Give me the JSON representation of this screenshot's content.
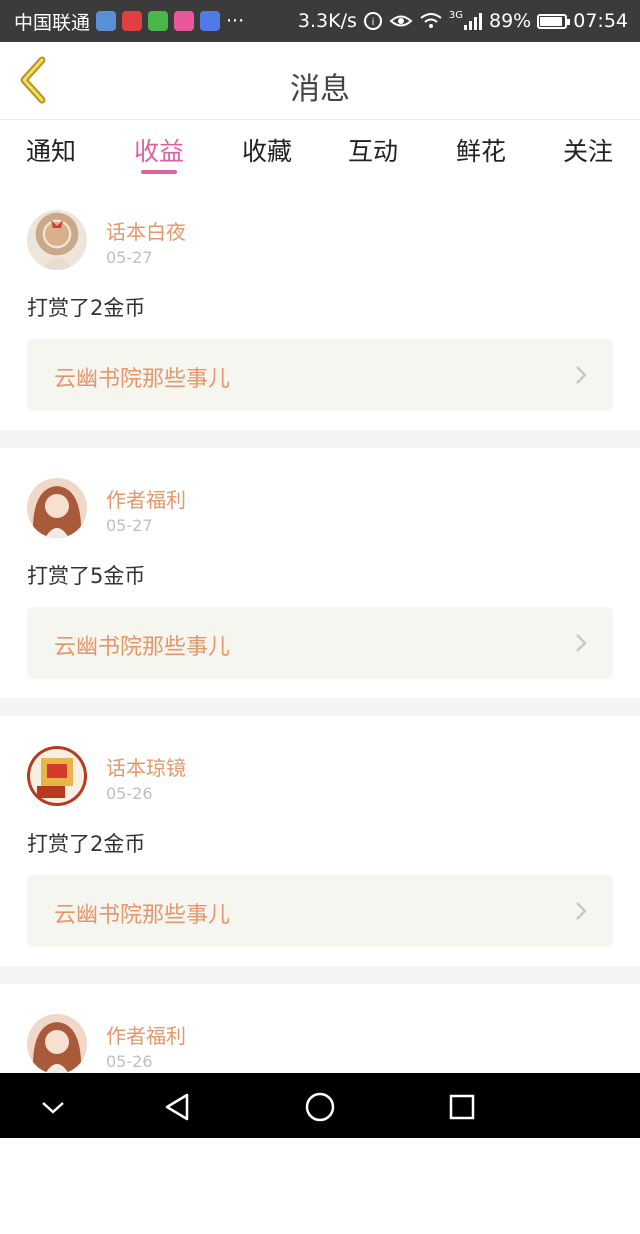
{
  "status_bar": {
    "carrier": "中国联通",
    "more": "···",
    "speed": "3.3K/s",
    "network": "3G",
    "battery": "89%",
    "battery_level": 0.89,
    "time": "07:54"
  },
  "header": {
    "title": "消息"
  },
  "tabs": [
    {
      "label": "通知"
    },
    {
      "label": "收益"
    },
    {
      "label": "收藏"
    },
    {
      "label": "互动"
    },
    {
      "label": "鲜花"
    },
    {
      "label": "关注"
    }
  ],
  "active_tab": "收益",
  "items": [
    {
      "name": "话本白夜",
      "date": "05-27",
      "message": "打赏了2金币",
      "book": "云幽书院那些事儿"
    },
    {
      "name": "作者福利",
      "date": "05-27",
      "message": "打赏了5金币",
      "book": "云幽书院那些事儿"
    },
    {
      "name": "话本琼镜",
      "date": "05-26",
      "message": "打赏了2金币",
      "book": "云幽书院那些事儿"
    },
    {
      "name": "作者福利",
      "date": "05-26"
    }
  ],
  "colors": {
    "accent": "#e061a1",
    "name": "#e5976a",
    "card_bg": "#f6f6f1",
    "back_icon": "#b8941f"
  },
  "icons": [
    "back-chevron-icon",
    "chevron-right-icon",
    "nav-down-icon",
    "nav-back-icon",
    "nav-home-icon",
    "nav-recent-icon"
  ]
}
